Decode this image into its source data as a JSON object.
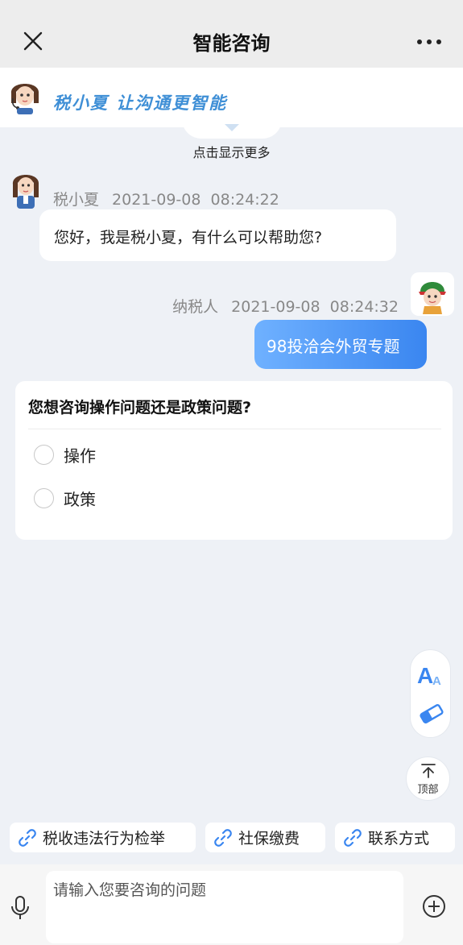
{
  "header": {
    "title": "智能咨询",
    "close_icon": "close-icon",
    "more_icon": "more-dots-icon"
  },
  "banner": {
    "slogan": "税小夏 让沟通更智能",
    "show_more": "点击显示更多"
  },
  "messages": [
    {
      "sender": "税小夏",
      "time": "2021-09-08  08:24:22",
      "text": "您好，我是税小夏，有什么可以帮助您?"
    },
    {
      "sender": "纳税人",
      "time": "2021-09-08  08:24:32",
      "text": "98投洽会外贸专题"
    }
  ],
  "question_card": {
    "question": "您想咨询操作问题还是政策问题?",
    "options": [
      "操作",
      "政策"
    ]
  },
  "tools": {
    "font_icon": "font-size-icon",
    "eraser_icon": "eraser-icon",
    "top_label": "顶部"
  },
  "quick_links": [
    "税收违法行为检举",
    "社保缴费",
    "联系方式"
  ],
  "input": {
    "placeholder": "请输入您要咨询的问题",
    "value": ""
  },
  "colors": {
    "accent": "#3a86f0",
    "bubble_gradient_start": "#6fb1ff",
    "link_icon": "#3a86f0",
    "background": "#eef1f6"
  }
}
